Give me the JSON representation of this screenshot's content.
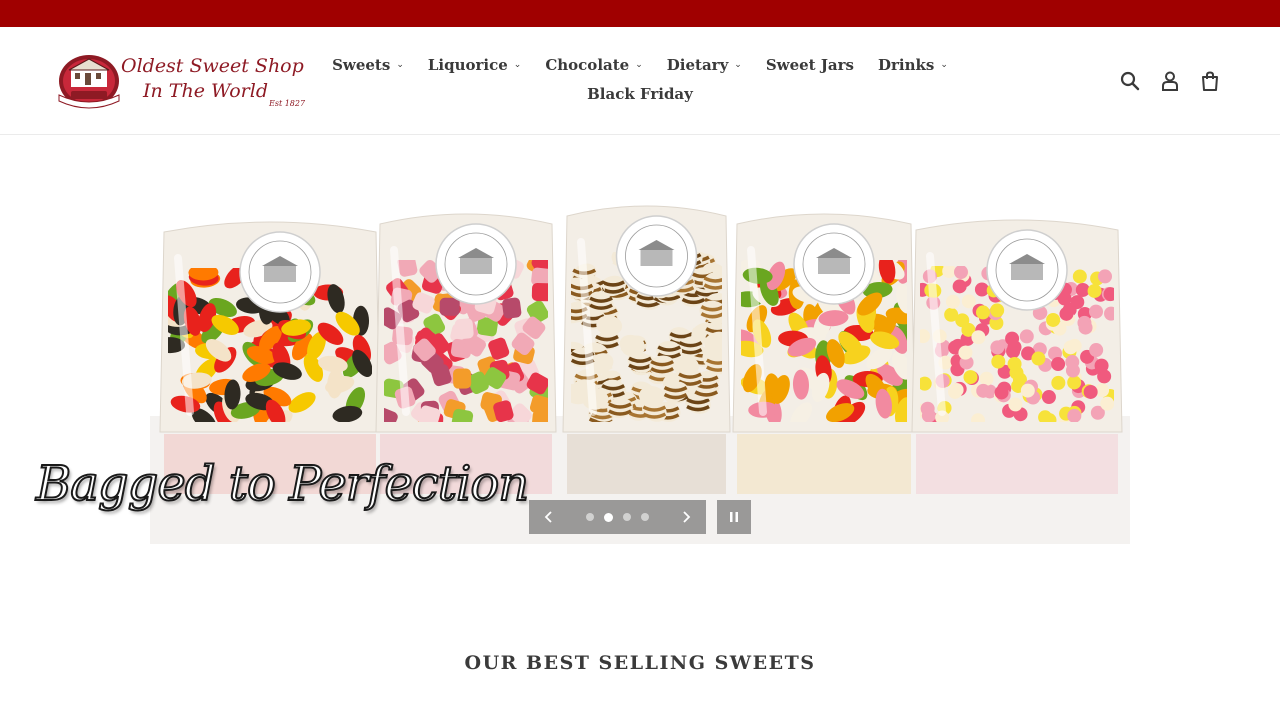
{
  "colors": {
    "announcement_bar": "#a00000",
    "text": "#3a3a3a",
    "logo": "#8e1a24",
    "border": "#ebebeb"
  },
  "logo": {
    "line1": "Oldest Sweet Shop",
    "line2": "In The World",
    "est": "Est 1827"
  },
  "nav": {
    "row1": [
      {
        "label": "Sweets",
        "dropdown": true
      },
      {
        "label": "Liquorice",
        "dropdown": true
      },
      {
        "label": "Chocolate",
        "dropdown": true
      },
      {
        "label": "Dietary",
        "dropdown": true
      },
      {
        "label": "Sweet Jars",
        "dropdown": false
      },
      {
        "label": "Drinks",
        "dropdown": true
      }
    ],
    "row2": [
      {
        "label": "Black Friday",
        "dropdown": false
      }
    ]
  },
  "header_icons": [
    "search-icon",
    "account-icon",
    "cart-icon"
  ],
  "hero": {
    "tagline": "Bagged to Perfection",
    "slide_count": 4,
    "active_slide": 2
  },
  "section": {
    "title": "OUR BEST SELLING SWEETS"
  }
}
